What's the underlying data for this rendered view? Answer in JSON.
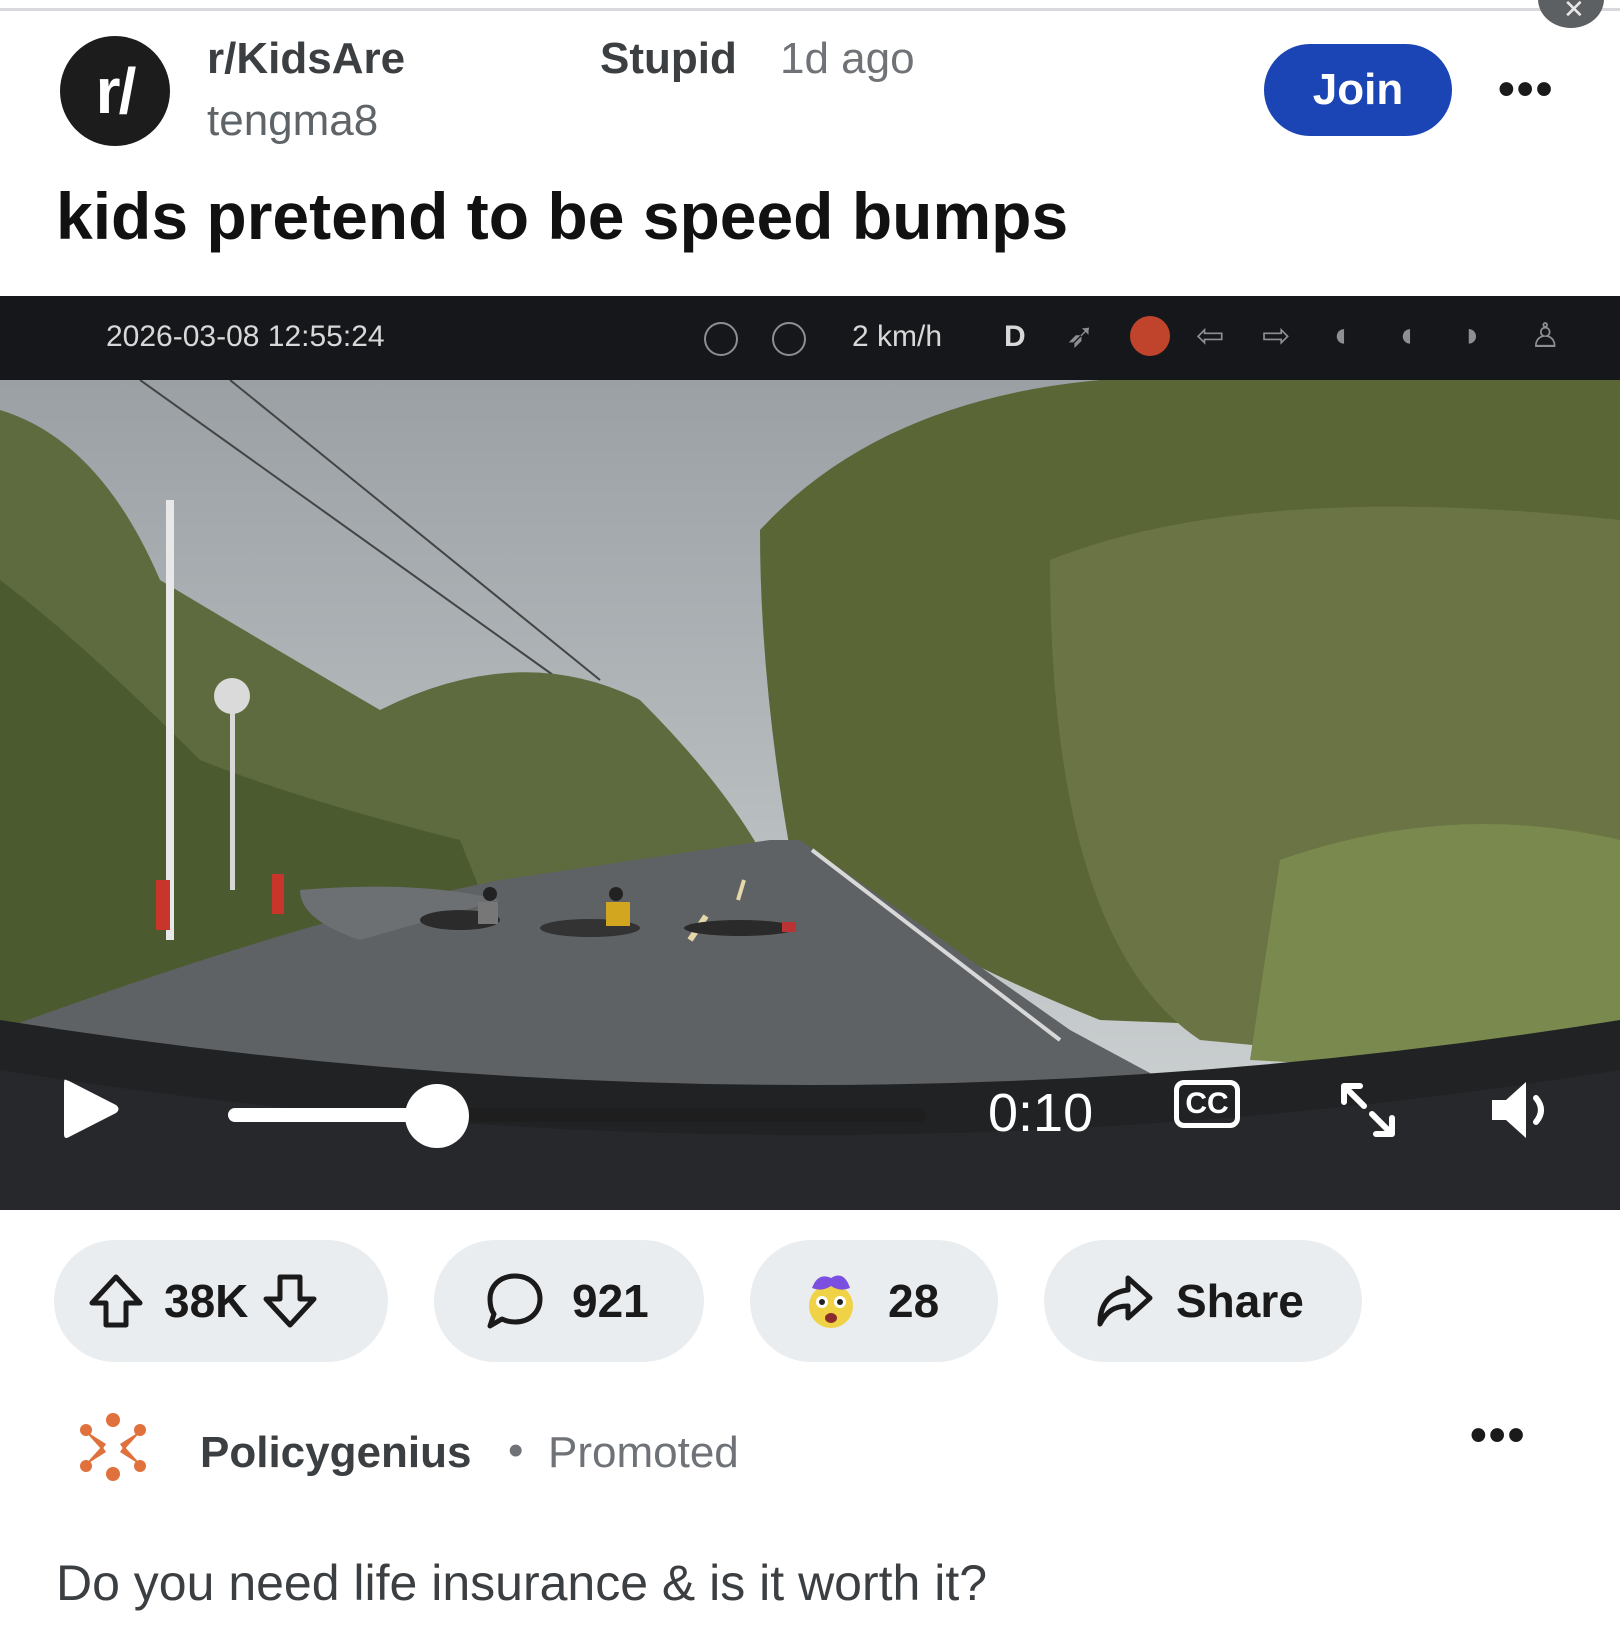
{
  "post": {
    "subreddit_line1": "r/KidsAre",
    "subreddit_line2": "Stupid",
    "time_ago": "1d ago",
    "username": "tengma8",
    "avatar_text": "r/",
    "join_label": "Join",
    "more_label": "•••",
    "title": "kids pretend to be speed bumps"
  },
  "video": {
    "hud_date": "2026-03-08  12:55:24",
    "hud_speed": "2  km/h",
    "hud_gear": "D",
    "time": "0:10",
    "progress_fraction": 0.3,
    "cc_label": "CC"
  },
  "actions": {
    "votes": "38K",
    "comments": "921",
    "awards": "28",
    "share_label": "Share"
  },
  "ad": {
    "brand": "Policygenius",
    "separator": "•",
    "promoted": "Promoted",
    "more_label": "•••",
    "headline": "Do you need life insurance & is it worth it?"
  },
  "colors": {
    "join_button": "#1b45b4",
    "pill_bg": "#eaedef",
    "ad_logo": "#e0713c"
  }
}
